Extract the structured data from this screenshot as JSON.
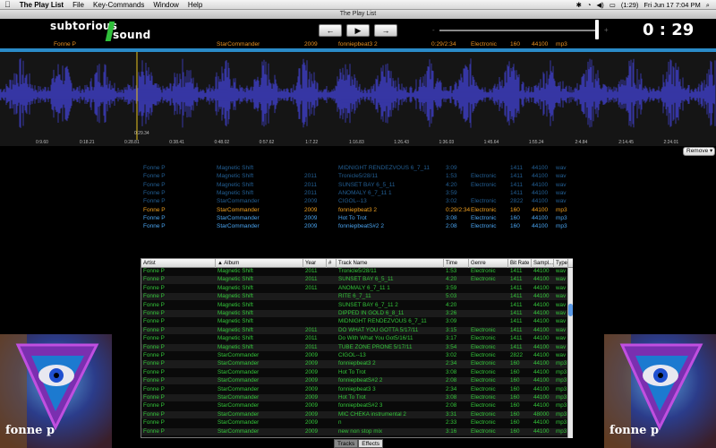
{
  "menubar": {
    "apple": "",
    "app_name": "The Play List",
    "items": [
      "File",
      "Key-Commands",
      "Window",
      "Help"
    ],
    "status": {
      "battery": "(1:29)",
      "clock": "Fri Jun 17  7:04 PM"
    }
  },
  "window_title": "The Play List",
  "logo": {
    "line1": "subtorious",
    "line2": "sound"
  },
  "transport": {
    "prev": "←",
    "play": "▶",
    "next": "→"
  },
  "volume": {
    "min_icon": "-",
    "max_icon": "+",
    "level": 1.0
  },
  "timer": "0 : 29",
  "now_playing": {
    "artist": "Fonne P",
    "album": "StarCommander",
    "year": "2009",
    "track": "fonniepbeat3 2",
    "time": "0:29/2:34",
    "genre": "Electronic",
    "bitrate": "160",
    "sample": "44100",
    "type": "mp3"
  },
  "waveform": {
    "position_label": "0:29.34",
    "ticks": [
      "0:9.60",
      "0:18.21",
      "0:28.81",
      "0:38.41",
      "0:48.02",
      "0:57.62",
      "1:7.22",
      "1:16.83",
      "1:26.43",
      "1:36.03",
      "1:45.64",
      "1:55.24",
      "2:4.84",
      "2:14.45",
      "2:24.01"
    ]
  },
  "remove_button": "Remove ▾",
  "queue": [
    {
      "artist": "Fonne P",
      "album": "Magnetic Shift",
      "year": "",
      "track": "MIDNIGHT RENDEZVOUS 6_7_11",
      "time": "3:09",
      "genre": "",
      "bitrate": "1411",
      "sample": "44100",
      "type": "wav",
      "style": "dim"
    },
    {
      "artist": "Fonne P",
      "album": "Magnetic Shift",
      "year": "2011",
      "track": "Tronicle5/28/11",
      "time": "1:53",
      "genre": "Electronic",
      "bitrate": "1411",
      "sample": "44100",
      "type": "wav",
      "style": "dim"
    },
    {
      "artist": "Fonne P",
      "album": "Magnetic Shift",
      "year": "2011",
      "track": "SUNSET BAY 6_5_11",
      "time": "4:20",
      "genre": "Electronic",
      "bitrate": "1411",
      "sample": "44100",
      "type": "wav",
      "style": "dim"
    },
    {
      "artist": "Fonne P",
      "album": "Magnetic Shift",
      "year": "2011",
      "track": "ANOMALY 6_7_11 1",
      "time": "3:59",
      "genre": "",
      "bitrate": "1411",
      "sample": "44100",
      "type": "wav",
      "style": "dim"
    },
    {
      "artist": "Fonne P",
      "album": "StarCommander",
      "year": "2009",
      "track": "CIGOL--13",
      "time": "3:02",
      "genre": "Electronic",
      "bitrate": "2822",
      "sample": "44100",
      "type": "wav",
      "style": "dim"
    },
    {
      "artist": "Fonne P",
      "album": "StarCommander",
      "year": "2009",
      "track": "fonniepbeat3 2",
      "time": "0:29/2:34",
      "genre": "Electronic",
      "bitrate": "160",
      "sample": "44100",
      "type": "mp3",
      "style": "orange"
    },
    {
      "artist": "Fonne P",
      "album": "StarCommander",
      "year": "2009",
      "track": "Hot To Trot",
      "time": "3:08",
      "genre": "Electronic",
      "bitrate": "160",
      "sample": "44100",
      "type": "mp3",
      "style": "bright"
    },
    {
      "artist": "Fonne P",
      "album": "StarCommander",
      "year": "2009",
      "track": "fonniepbeatS#2 2",
      "time": "2:08",
      "genre": "Electronic",
      "bitrate": "160",
      "sample": "44100",
      "type": "mp3",
      "style": "bright"
    }
  ],
  "table": {
    "columns": [
      "Artist",
      "▲ Album",
      "Year",
      "#",
      "Track Name",
      "Time",
      "Genre",
      "Bit Rate",
      "Sampl...",
      "Type"
    ],
    "rows": [
      [
        "Fonne P",
        "Magnetic Shift",
        "2011",
        "",
        "Tronicle5/28/11",
        "1:53",
        "Electronic",
        "1411",
        "44100",
        "wav"
      ],
      [
        "Fonne P",
        "Magnetic Shift",
        "2011",
        "",
        "SUNSET BAY 6_5_11",
        "4:20",
        "Electronic",
        "1411",
        "44100",
        "wav"
      ],
      [
        "Fonne P",
        "Magnetic Shift",
        "2011",
        "",
        "ANOMALY 6_7_11 1",
        "3:59",
        "",
        "1411",
        "44100",
        "wav"
      ],
      [
        "Fonne P",
        "Magnetic Shift",
        "",
        "",
        "RITE 6_7_11",
        "5:03",
        "",
        "1411",
        "44100",
        "wav"
      ],
      [
        "Fonne P",
        "Magnetic Shift",
        "",
        "",
        "SUNSET BAY 6_7_11 2",
        "4:20",
        "",
        "1411",
        "44100",
        "wav"
      ],
      [
        "Fonne P",
        "Magnetic Shift",
        "",
        "",
        "DIPPED IN GOLD 6_8_11",
        "3:26",
        "",
        "1411",
        "44100",
        "wav"
      ],
      [
        "Fonne P",
        "Magnetic Shift",
        "",
        "",
        "MIDNIGHT RENDEZVOUS 6_7_11",
        "3:09",
        "",
        "1411",
        "44100",
        "wav"
      ],
      [
        "Fonne P",
        "Magnetic Shift",
        "2011",
        "",
        "DO WHAT YOU GOTTA 5/17/11",
        "3:15",
        "Electronic",
        "1411",
        "44100",
        "wav"
      ],
      [
        "Fonne P",
        "Magnetic Shift",
        "2011",
        "",
        "Do With What You Got5/16/11",
        "3:17",
        "Electronic",
        "1411",
        "44100",
        "wav"
      ],
      [
        "Fonne P",
        "Magnetic Shift",
        "2011",
        "",
        "TUBE ZONE PRONE 5/17/11",
        "3:54",
        "Electronic",
        "1411",
        "44100",
        "wav"
      ],
      [
        "Fonne P",
        "StarCommander",
        "2009",
        "",
        "CIGOL--13",
        "3:02",
        "Electronic",
        "2822",
        "44100",
        "wav"
      ],
      [
        "Fonne P",
        "StarCommander",
        "2009",
        "",
        "fonniepbeat3 2",
        "2:34",
        "Electronic",
        "160",
        "44100",
        "mp3"
      ],
      [
        "Fonne P",
        "StarCommander",
        "2009",
        "",
        "Hot To Trot",
        "3:08",
        "Electronic",
        "160",
        "44100",
        "mp3"
      ],
      [
        "Fonne P",
        "StarCommander",
        "2009",
        "",
        "fonniepbeatS#2 2",
        "2:08",
        "Electronic",
        "160",
        "44100",
        "mp3"
      ],
      [
        "Fonne P",
        "StarCommander",
        "2009",
        "",
        "fonniepbeat3 3",
        "2:34",
        "Electronic",
        "160",
        "44100",
        "mp3"
      ],
      [
        "Fonne P",
        "StarCommander",
        "2009",
        "",
        "Hot To Trot",
        "3:08",
        "Electronic",
        "160",
        "44100",
        "mp3"
      ],
      [
        "Fonne P",
        "StarCommander",
        "2009",
        "",
        "fonniepbeatS#2 3",
        "2:08",
        "Electronic",
        "160",
        "44100",
        "mp3"
      ],
      [
        "Fonne P",
        "StarCommander",
        "2009",
        "",
        "MIC CHEKA instrumental 2",
        "3:31",
        "Electronic",
        "160",
        "48000",
        "mp3"
      ],
      [
        "Fonne P",
        "StarCommander",
        "2009",
        "",
        "n",
        "2:33",
        "Electronic",
        "160",
        "44100",
        "mp3"
      ],
      [
        "Fonne P",
        "StarCommander",
        "2009",
        "",
        "new non stop mix",
        "3:16",
        "Electronic",
        "160",
        "44100",
        "mp3"
      ]
    ]
  },
  "tabs": [
    "Tracks",
    "Effects"
  ],
  "cover_caption": "fonne p",
  "colors": {
    "accent_blue": "#2a8bc8",
    "wave": "#3a3ab4",
    "playing": "#e8901f",
    "list_green": "#34c63a"
  }
}
